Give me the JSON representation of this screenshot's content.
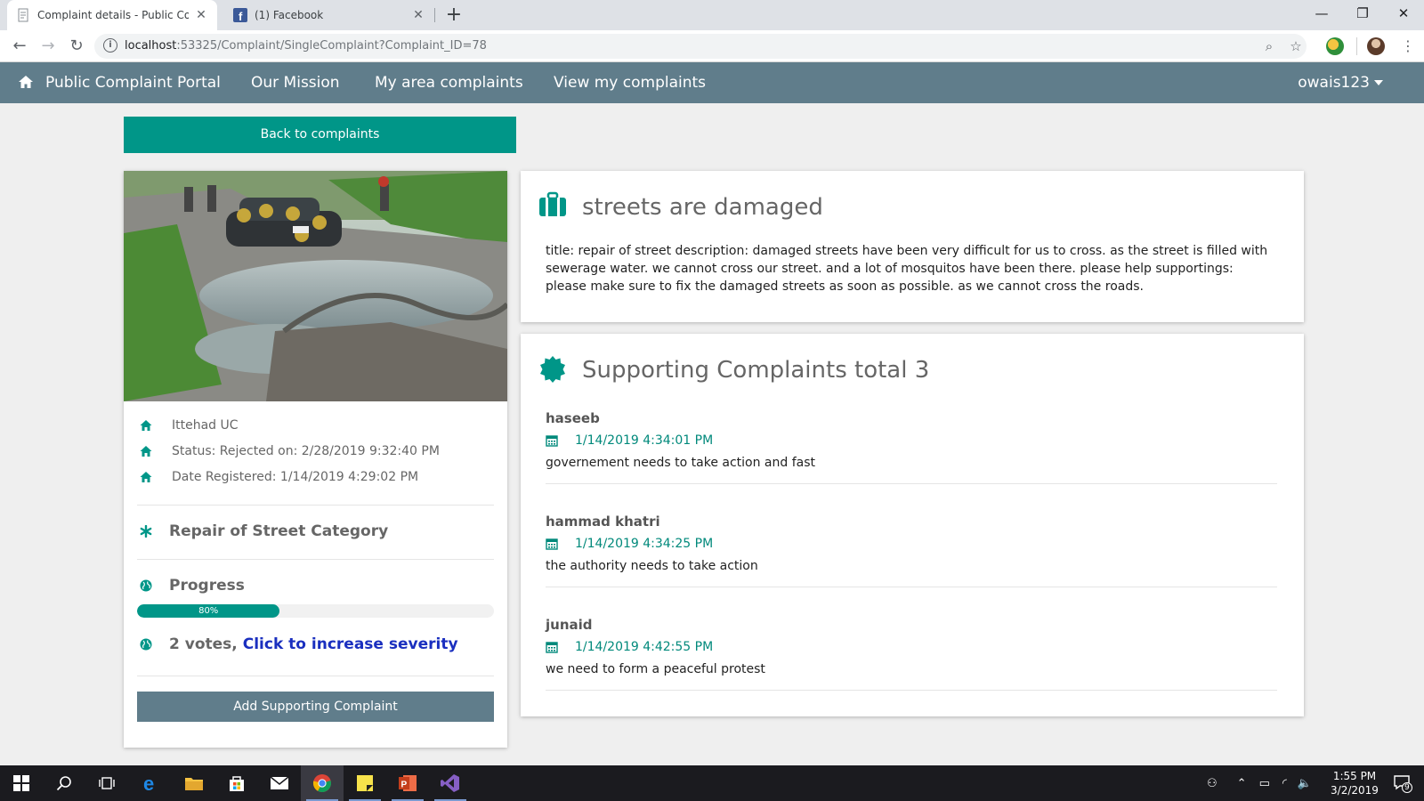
{
  "browser": {
    "tabs": [
      {
        "title": "Complaint details - Public Compl",
        "active": true
      },
      {
        "title": "(1) Facebook",
        "active": false
      }
    ],
    "url_host": "localhost",
    "url_rest": ":53325/Complaint/SingleComplaint?Complaint_ID=78",
    "window_controls": [
      "minimize",
      "restore",
      "close"
    ]
  },
  "nav": {
    "brand": "Public Complaint Portal",
    "links": [
      "Our Mission",
      "My area complaints",
      "View my complaints"
    ],
    "user": "owais123"
  },
  "back_button": "Back to complaints",
  "left": {
    "location": "Ittehad UC",
    "status": "Status: Rejected on: 2/28/2019 9:32:40 PM",
    "date_registered": "Date Registered: 1/14/2019 4:29:02 PM",
    "category": "Repair of Street Category",
    "progress_label": "Progress",
    "progress_value": 0.8,
    "progress_text": "80%",
    "votes_text": "2 votes,",
    "votes_link": "Click to increase severity",
    "add_button": "Add Supporting Complaint"
  },
  "complaint": {
    "title": "streets are damaged",
    "description": "title: repair of street description: damaged streets have been very difficult for us to cross. as the street is filled with sewerage water. we cannot cross our street. and a lot of mosquitos have been there. please help supportings: please make sure to fix the damaged streets as soon as possible. as we cannot cross the roads."
  },
  "supporting": {
    "title": "Supporting Complaints total 3",
    "items": [
      {
        "name": "haseeb",
        "date": "1/14/2019 4:34:01 PM",
        "text": "governement needs to take action and fast"
      },
      {
        "name": "hammad khatri",
        "date": "1/14/2019 4:34:25 PM",
        "text": "the authority needs to take action"
      },
      {
        "name": "junaid",
        "date": "1/14/2019 4:42:55 PM",
        "text": "we need to form a peaceful protest"
      }
    ]
  },
  "taskbar": {
    "time": "1:55 PM",
    "date": "3/2/2019",
    "notification_count": "9"
  },
  "colors": {
    "teal": "#009688",
    "navbar": "#607d8b",
    "link_blue": "#1a2fbf"
  }
}
